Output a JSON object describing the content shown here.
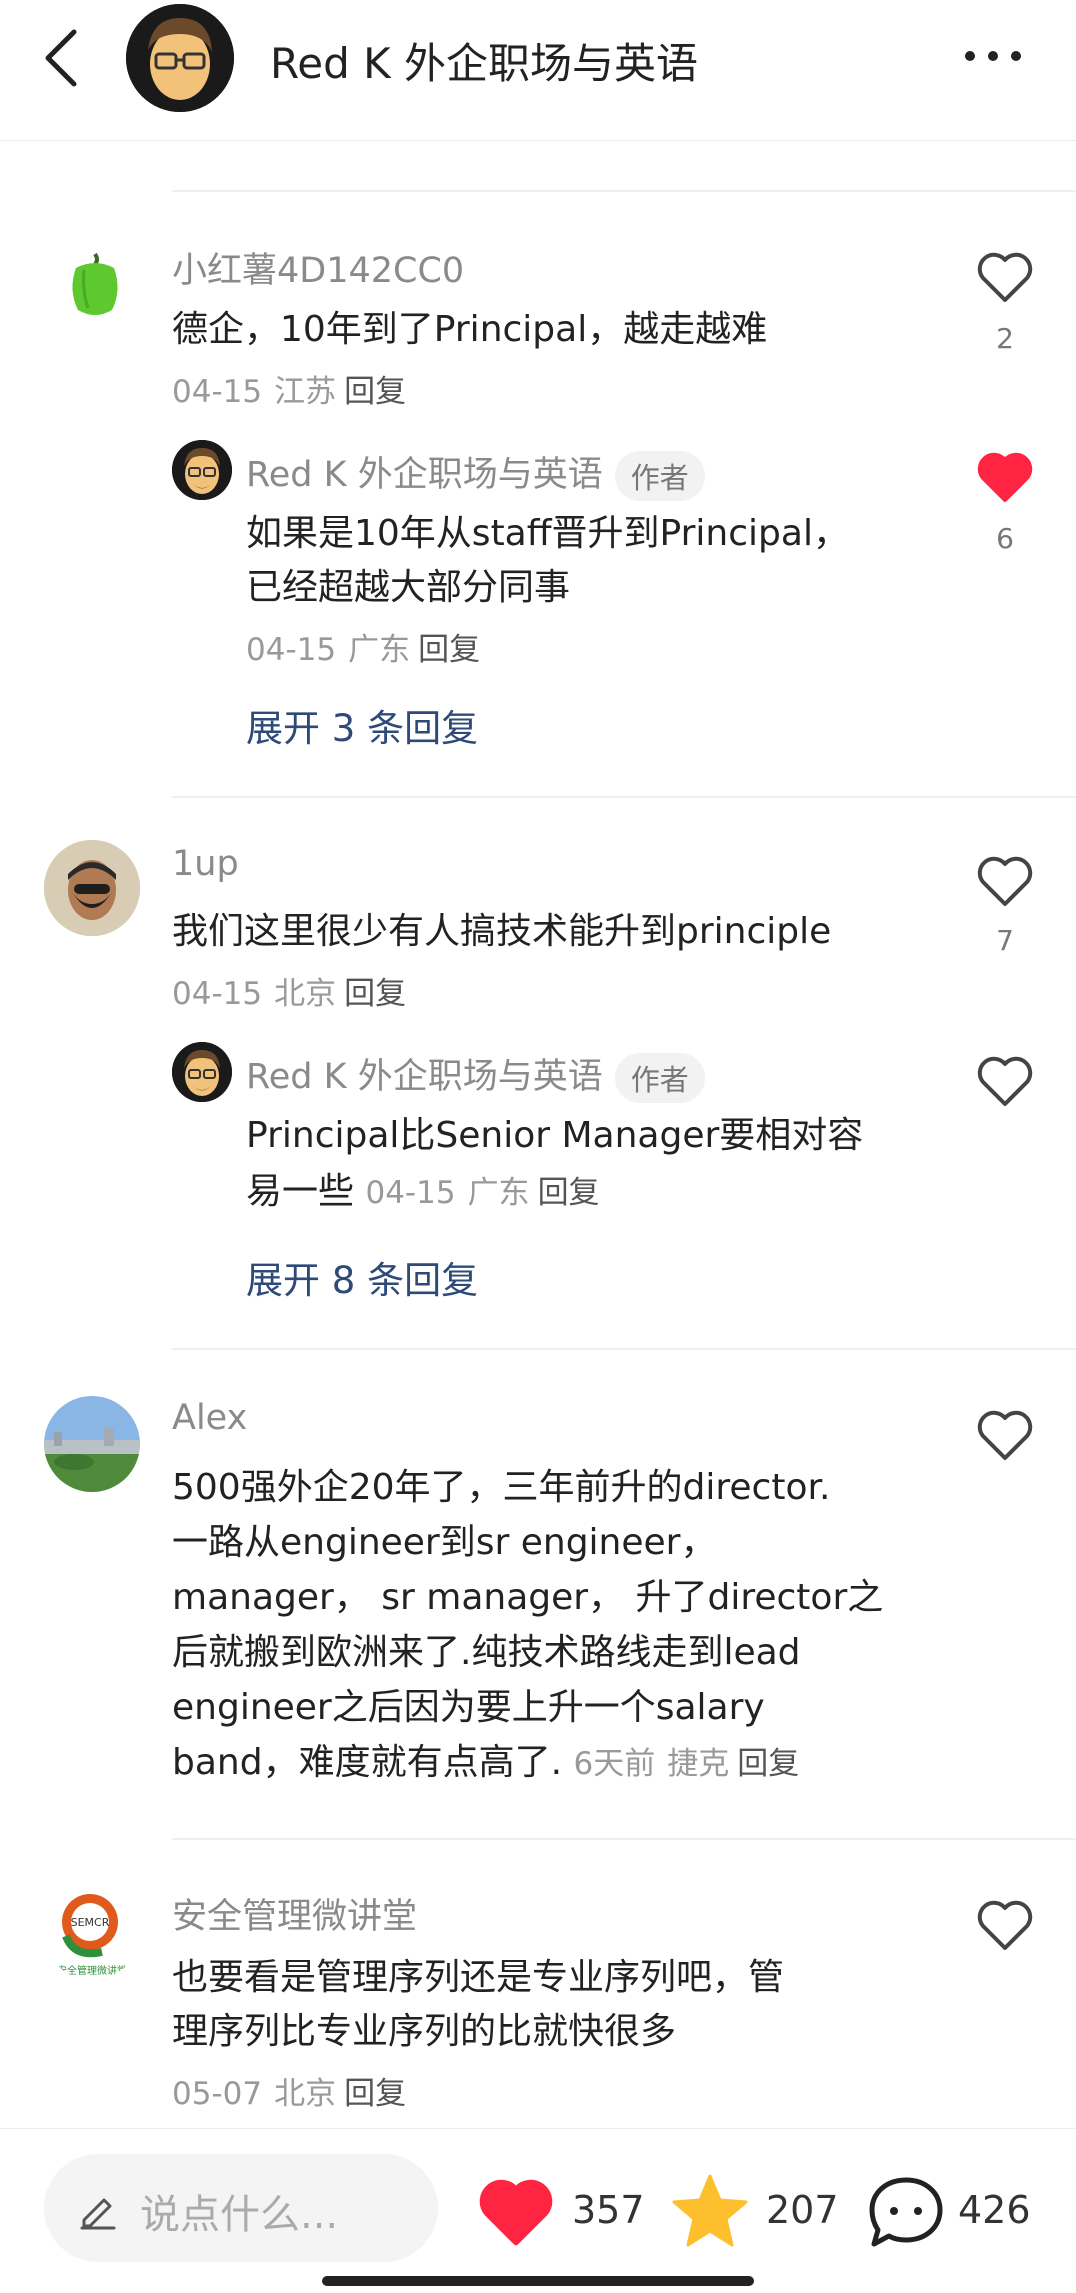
{
  "header": {
    "title": "Red K 外企职场与英语",
    "back_icon": "back-chevron-icon",
    "more_icon": "more-dots-icon"
  },
  "comments": [
    {
      "user": "小红薯4D142CC0",
      "text": "德企，10年到了Principal，越走越难",
      "date": "04-15",
      "location": "江苏",
      "reply_label": "回复",
      "likes": "2",
      "liked": false,
      "avatar_icon": "green-pepper-avatar",
      "reply": {
        "user": "Red K 外企职场与英语",
        "badge": "作者",
        "text_line1": "如果是10年从staff晋升到Principal，",
        "text_line2": "已经超越大部分同事",
        "date": "04-15",
        "location": "广东",
        "reply_label": "回复",
        "likes": "6",
        "liked": true
      },
      "expand_label": "展开 3 条回复"
    },
    {
      "user": "1up",
      "text": "我们这里很少有人搞技术能升到principle",
      "date": "04-15",
      "location": "北京",
      "reply_label": "回复",
      "likes": "7",
      "liked": false,
      "reply": {
        "user": "Red K 外企职场与英语",
        "badge": "作者",
        "text_line1": "Principal比Senior Manager要相对容",
        "text_line2": "易一些",
        "date": "04-15",
        "location": "广东",
        "reply_label": "回复",
        "likes": "",
        "liked": false
      },
      "expand_label": "展开 8 条回复"
    },
    {
      "user": "Alex",
      "lines": [
        "500强外企20年了，三年前升的director.",
        "一路从engineer到sr engineer，",
        "manager， sr manager， 升了director之",
        "后就搬到欧洲来了.纯技术路线走到lead",
        "engineer之后因为要上升一个salary",
        "band，难度就有点高了."
      ],
      "date": "6天前",
      "location": "捷克",
      "reply_label": "回复",
      "likes": "",
      "liked": false
    },
    {
      "user": "安全管理微讲堂",
      "lines": [
        "也要看是管理序列还是专业序列吧，管",
        "理序列比专业序列的比就快很多"
      ],
      "date": "05-07",
      "location": "北京",
      "reply_label": "回复",
      "likes": "",
      "liked": false,
      "avatar_text": "SEMCR",
      "avatar_caption": "安全管理微讲堂"
    }
  ],
  "bottom_bar": {
    "input_placeholder": "说点什么...",
    "likes": "357",
    "favorites": "207",
    "comments": "426"
  },
  "colors": {
    "liked_red": "#ff2442",
    "star_yellow": "#fdbf2e",
    "expand_blue": "#2e4a78",
    "meta_gray": "#999999"
  }
}
